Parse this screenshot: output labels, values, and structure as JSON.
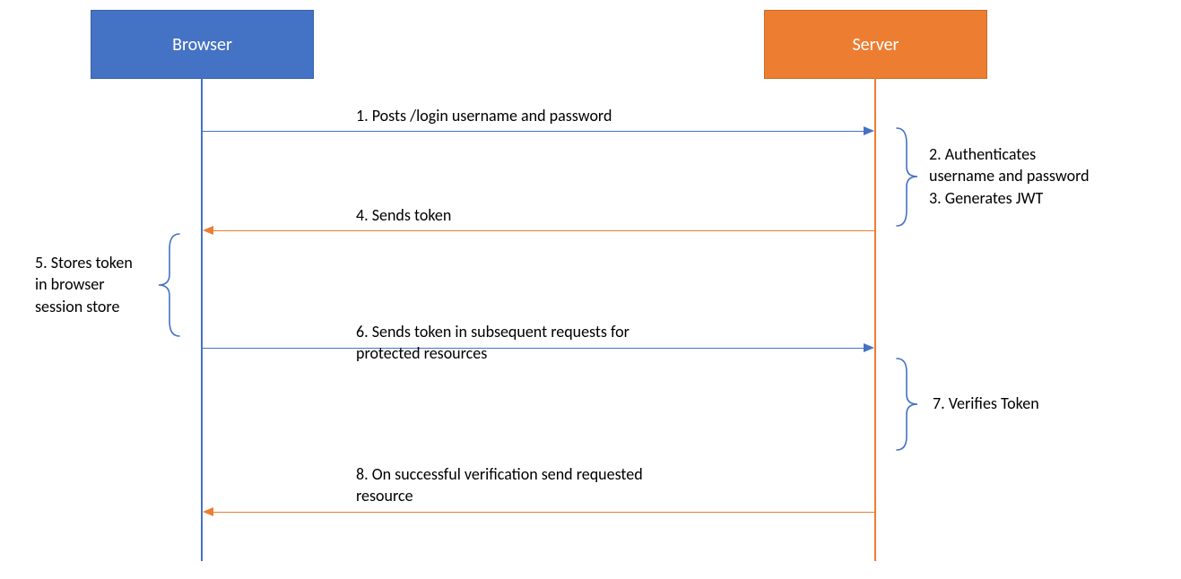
{
  "participants": {
    "browser": "Browser",
    "server": "Server"
  },
  "messages": {
    "m1": "1. Posts /login username and password",
    "m4": "4. Sends token",
    "m6a": "6. Sends token in subsequent requests for",
    "m6b": "protected resources",
    "m8a": "8. On successful verification send requested",
    "m8b": "resource"
  },
  "notes": {
    "n23a": "2. Authenticates",
    "n23b": "username and password",
    "n23c": "3. Generates JWT",
    "n5a": "5. Stores token",
    "n5b": "in browser",
    "n5c": "session store",
    "n7": "7. Verifies Token"
  },
  "colors": {
    "browser": "#4472C4",
    "server": "#ED7D31"
  }
}
